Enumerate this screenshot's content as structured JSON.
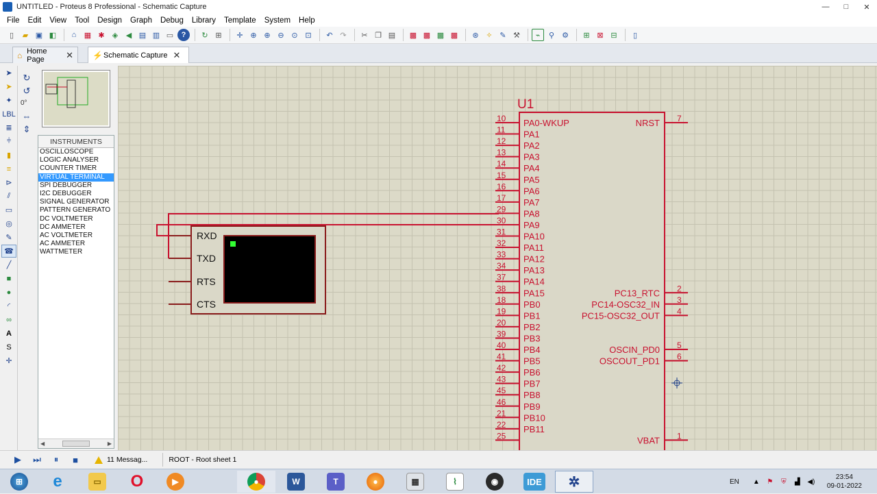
{
  "window": {
    "title": "UNTITLED - Proteus 8 Professional - Schematic Capture",
    "controls": [
      "—",
      "□",
      "✕"
    ]
  },
  "menu": [
    "File",
    "Edit",
    "View",
    "Tool",
    "Design",
    "Graph",
    "Debug",
    "Library",
    "Template",
    "System",
    "Help"
  ],
  "tabs": [
    {
      "label": "Home Page",
      "active": false
    },
    {
      "label": "Schematic Capture",
      "active": true
    }
  ],
  "rotation": {
    "angle": "0°"
  },
  "devices": {
    "header": "INSTRUMENTS",
    "items": [
      "OSCILLOSCOPE",
      "LOGIC ANALYSER",
      "COUNTER TIMER",
      "VIRTUAL TERMINAL",
      "SPI DEBUGGER",
      "I2C DEBUGGER",
      "SIGNAL GENERATOR",
      "PATTERN GENERATO",
      "DC VOLTMETER",
      "DC AMMETER",
      "AC VOLTMETER",
      "AC AMMETER",
      "WATTMETER"
    ],
    "selected": "VIRTUAL TERMINAL"
  },
  "terminal": {
    "pins": [
      "RXD",
      "TXD",
      "RTS",
      "CTS"
    ]
  },
  "chip": {
    "ref": "U1",
    "left_pins": [
      {
        "num": "10",
        "name": "PA0-WKUP"
      },
      {
        "num": "11",
        "name": "PA1"
      },
      {
        "num": "12",
        "name": "PA2"
      },
      {
        "num": "13",
        "name": "PA3"
      },
      {
        "num": "14",
        "name": "PA4"
      },
      {
        "num": "15",
        "name": "PA5"
      },
      {
        "num": "16",
        "name": "PA6"
      },
      {
        "num": "17",
        "name": "PA7"
      },
      {
        "num": "29",
        "name": "PA8"
      },
      {
        "num": "30",
        "name": "PA9"
      },
      {
        "num": "31",
        "name": "PA10"
      },
      {
        "num": "32",
        "name": "PA11"
      },
      {
        "num": "33",
        "name": "PA12"
      },
      {
        "num": "34",
        "name": "PA13"
      },
      {
        "num": "37",
        "name": "PA14"
      },
      {
        "num": "38",
        "name": "PA15"
      },
      {
        "num": "18",
        "name": "PB0"
      },
      {
        "num": "19",
        "name": "PB1"
      },
      {
        "num": "20",
        "name": "PB2"
      },
      {
        "num": "39",
        "name": "PB3"
      },
      {
        "num": "40",
        "name": "PB4"
      },
      {
        "num": "41",
        "name": "PB5"
      },
      {
        "num": "42",
        "name": "PB6"
      },
      {
        "num": "43",
        "name": "PB7"
      },
      {
        "num": "45",
        "name": "PB8"
      },
      {
        "num": "46",
        "name": "PB9"
      },
      {
        "num": "21",
        "name": "PB10"
      },
      {
        "num": "22",
        "name": "PB11"
      },
      {
        "num": "25",
        "name": ""
      }
    ],
    "right_pins": [
      {
        "num": "7",
        "name": "NRST"
      },
      {
        "num": "2",
        "name": "PC13_RTC"
      },
      {
        "num": "3",
        "name": "PC14-OSC32_IN"
      },
      {
        "num": "4",
        "name": "PC15-OSC32_OUT"
      },
      {
        "num": "5",
        "name": "OSCIN_PD0"
      },
      {
        "num": "6",
        "name": "OSCOUT_PD1"
      },
      {
        "num": "1",
        "name": "VBAT"
      }
    ]
  },
  "status": {
    "messages": "11 Messag...",
    "sheet": "ROOT - Root sheet 1"
  },
  "taskbar": {
    "apps": [
      "start",
      "internet-explorer",
      "file-explorer",
      "opera",
      "media-player",
      "chrome",
      "word",
      "teams",
      "firefox",
      "calculator",
      "graph-app",
      "obs",
      "IDE",
      "proteus"
    ],
    "ide_label": "IDE",
    "lang": "EN",
    "time": "23:54",
    "date": "09-01-2022"
  },
  "colors": {
    "canvas": "#dcdac8",
    "wire": "#c8102e",
    "chip_body": "#dad8c8",
    "selection": "#3399ff"
  }
}
